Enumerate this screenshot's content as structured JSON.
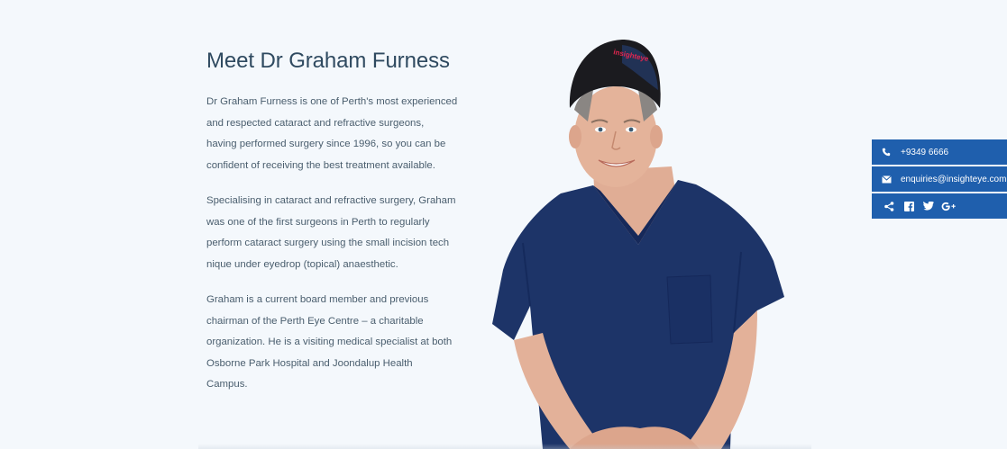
{
  "heading": "Meet Dr Graham Furness",
  "paragraphs": [
    {
      "lines": [
        "Dr Graham Furness is one of Perth's most experienced",
        "and respected cataract and refractive surgeons,",
        "having performed surgery since 1996, so you can be",
        "confident of receiving the best treatment available."
      ]
    },
    {
      "lines": [
        "Specialising in cataract and refractive surgery, Graham",
        "was one of the first surgeons in Perth to regularly",
        "perform cataract surgery using the small incision tech",
        "nique under eyedrop (topical) anaesthetic."
      ]
    },
    {
      "lines": [
        "Graham is a current board member and previous",
        "chairman of the Perth Eye Centre – a charitable",
        "organization. He is a visiting medical specialist at both",
        "Osborne Park Hospital and Joondalup Health",
        "Campus."
      ]
    }
  ],
  "portrait": {
    "cap_text": "insighteye"
  },
  "contact": {
    "phone": "+9349 6666",
    "phone_icon": "phone-icon",
    "email": "enquiries@insighteye.com.au",
    "email_icon": "envelope-icon",
    "social_icons": [
      "share-icon",
      "facebook-icon",
      "twitter-icon",
      "google-plus-icon"
    ]
  },
  "colors": {
    "background": "#f4f8fc",
    "accent": "#1f5fad",
    "heading": "#2f4a60",
    "body_text": "#4a5e6e",
    "scrubs": "#1d3468"
  }
}
